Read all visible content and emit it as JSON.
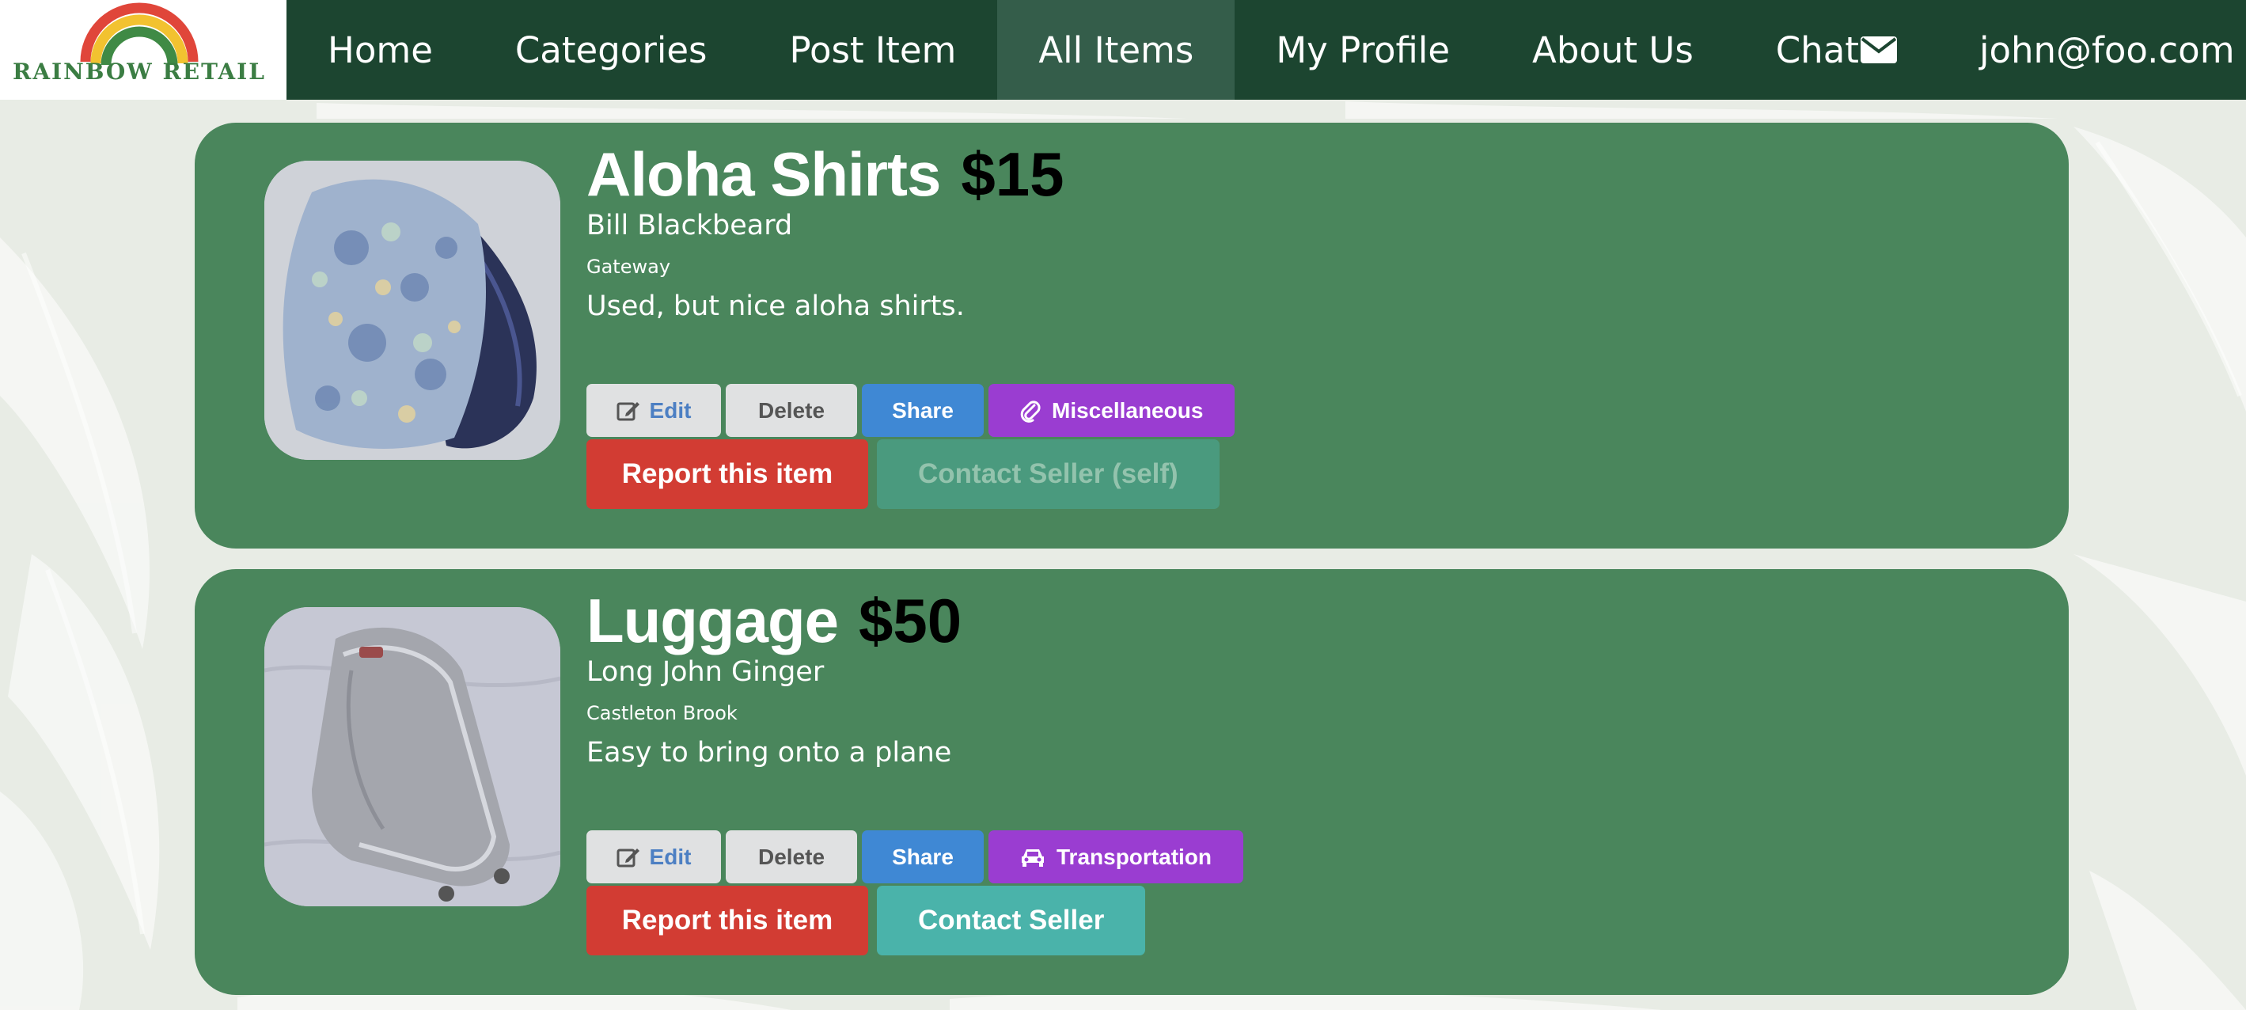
{
  "brand": {
    "name": "RAINBOW RETAIL",
    "colors": {
      "nav_bg": "#1c4530",
      "nav_active": "#345d4a",
      "card_bg": "#4a865c",
      "report": "#d23c33",
      "contact": "#4ab3aa",
      "share": "#3f88d4",
      "category": "#9a3dd1"
    }
  },
  "nav": {
    "items": [
      {
        "label": "Home",
        "active": false
      },
      {
        "label": "Categories",
        "active": false
      },
      {
        "label": "Post Item",
        "active": false
      },
      {
        "label": "All Items",
        "active": true
      },
      {
        "label": "My Profile",
        "active": false
      },
      {
        "label": "About Us",
        "active": false
      },
      {
        "label": "Chat",
        "icon": "envelope-icon",
        "active": false
      },
      {
        "label": "john@foo.com",
        "active": false
      }
    ]
  },
  "items": [
    {
      "name": "Aloha Shirts",
      "price": "$15",
      "seller": "Bill Blackbeard",
      "location": "Gateway",
      "description": "Used, but nice aloha shirts.",
      "image": "aloha-shirts-photo",
      "actions": {
        "edit": "Edit",
        "delete": "Delete",
        "share": "Share"
      },
      "category": {
        "label": "Miscellaneous",
        "icon": "paperclip-icon"
      },
      "report_label": "Report this item",
      "contact_label": "Contact Seller (self)",
      "contact_disabled": true
    },
    {
      "name": "Luggage",
      "price": "$50",
      "seller": "Long John Ginger",
      "location": "Castleton Brook",
      "description": "Easy to bring onto a plane",
      "image": "luggage-photo",
      "actions": {
        "edit": "Edit",
        "delete": "Delete",
        "share": "Share"
      },
      "category": {
        "label": "Transportation",
        "icon": "car-icon"
      },
      "report_label": "Report this item",
      "contact_label": "Contact Seller",
      "contact_disabled": false
    }
  ]
}
